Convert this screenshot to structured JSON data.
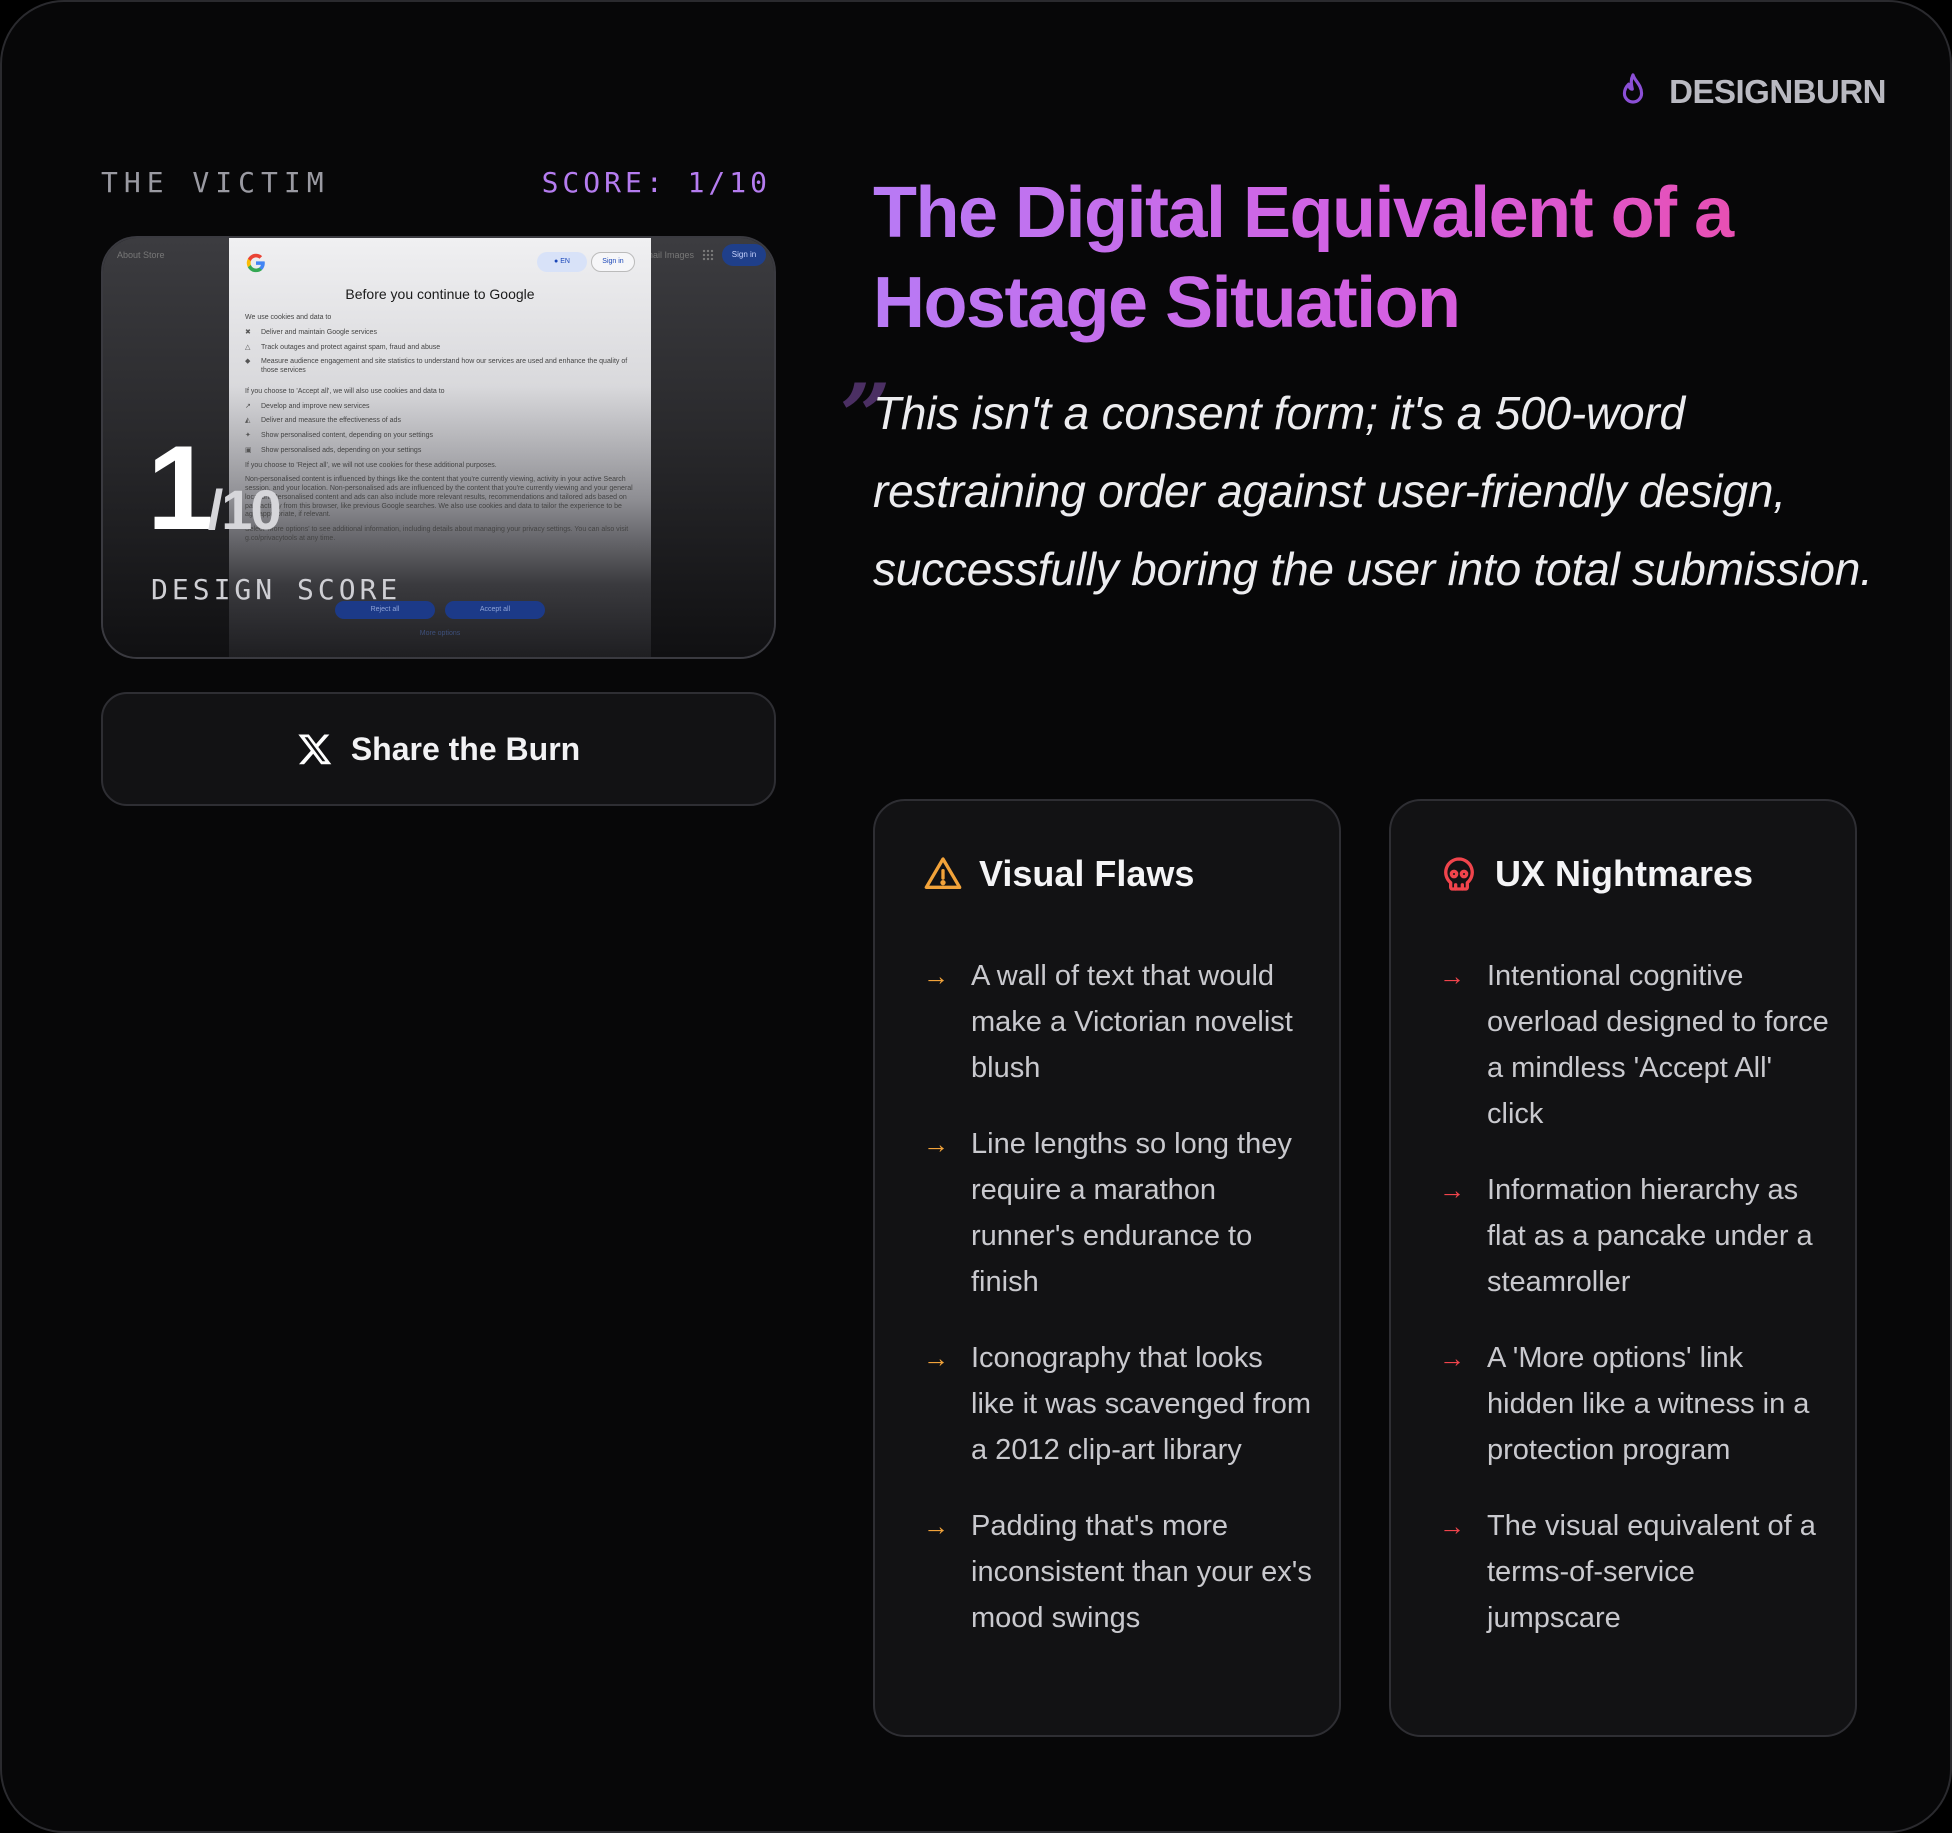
{
  "brand": {
    "name": "DESIGNBURN",
    "icon": "flame-icon",
    "icon_color": "#8b4fd6"
  },
  "victim": {
    "label": "THE VICTIM",
    "score_label": "SCORE: 1/10",
    "score_value": "1",
    "score_denominator": "/10",
    "design_score_label": "DESIGN SCORE",
    "screenshot": {
      "topbar_left": "About   Store",
      "topbar_right": "Gmail   Images",
      "signin_top": "Sign in",
      "lang_chip": "EN",
      "signin_chip": "Sign in",
      "title": "Before you continue to Google",
      "intro": "We use cookies and data to",
      "items_a": [
        "Deliver and maintain Google services",
        "Track outages and protect against spam, fraud and abuse",
        "Measure audience engagement and site statistics to understand how our services are used and enhance the quality of those services"
      ],
      "accept_intro": "If you choose to 'Accept all', we will also use cookies and data to",
      "items_b": [
        "Develop and improve new services",
        "Deliver and measure the effectiveness of ads",
        "Show personalised content, depending on your settings",
        "Show personalised ads, depending on your settings"
      ],
      "reject_intro": "If you choose to 'Reject all', we will not use cookies for these additional purposes.",
      "para": "Non-personalised content is influenced by things like the content that you're currently viewing, activity in your active Search session, and your location. Non-personalised ads are influenced by the content that you're currently viewing and your general location. Personalised content and ads can also include more relevant results, recommendations and tailored ads based on past activity from this browser, like previous Google searches. We also use cookies and data to tailor the experience to be age-appropriate, if relevant.",
      "para2": "Select 'More options' to see additional information, including details about managing your privacy settings. You can also visit g.co/privacytools at any time.",
      "reject_btn": "Reject all",
      "accept_btn": "Accept all",
      "more_options": "More options"
    }
  },
  "share": {
    "label": "Share the Burn",
    "icon": "x-logo-icon"
  },
  "headline": "The Digital Equivalent of a Hostage Situation",
  "quote_mark": "”",
  "quote": "This isn't a consent form; it's a 500-word restraining order against user-friendly design, successfully boring the user into total submission.",
  "cards": {
    "flaws": {
      "title": "Visual Flaws",
      "icon": "warning-icon",
      "accent": "#f2a33a",
      "items": [
        "A wall of text that would make a Victorian novelist blush",
        "Line lengths so long they require a marathon runner's endurance to finish",
        "Iconography that looks like it was scavenged from a 2012 clip-art library",
        "Padding that's more inconsistent than your ex's mood swings"
      ]
    },
    "ux": {
      "title": "UX Nightmares",
      "icon": "skull-icon",
      "accent": "#f0444c",
      "items": [
        "Intentional cognitive overload designed to force a mindless 'Accept All' click",
        "Information hierarchy as flat as a pancake under a steamroller",
        "A 'More options' link hidden like a witness in a protection program",
        "The visual equivalent of a terms-of-service jumpscare"
      ]
    }
  },
  "arrow_glyph": "→"
}
